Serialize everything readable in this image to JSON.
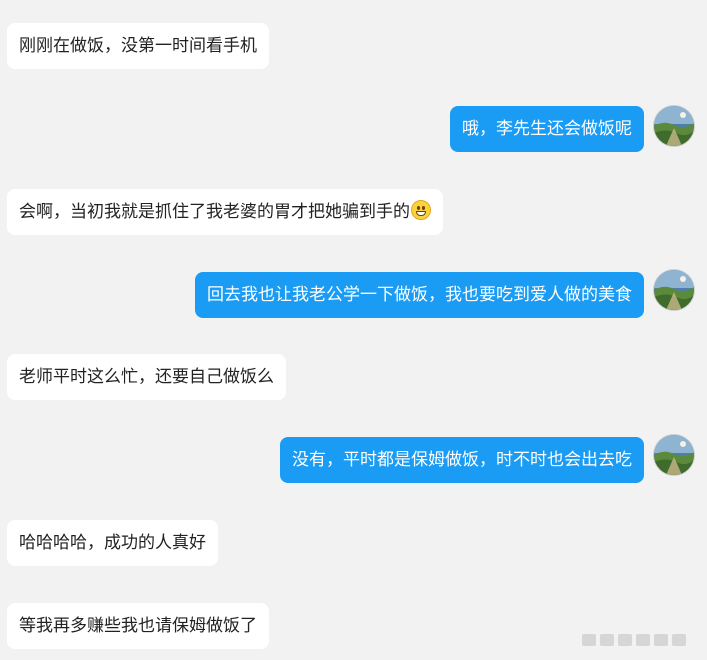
{
  "chat": {
    "messages": [
      {
        "side": "incoming",
        "text": "刚刚在做饭，没第一时间看手机"
      },
      {
        "side": "outgoing",
        "text": "哦，李先生还会做饭呢"
      },
      {
        "side": "incoming",
        "text": "会啊，当初我就是抓住了我老婆的胃才把她骗到手的",
        "emoji": "grinning-face"
      },
      {
        "side": "outgoing",
        "text": "回去我也让我老公学一下做饭，我也要吃到爱人做的美食"
      },
      {
        "side": "incoming",
        "text": "老师平时这么忙，还要自己做饭么"
      },
      {
        "side": "outgoing",
        "text": "没有，平时都是保姆做饭，时不时也会出去吃"
      },
      {
        "side": "incoming",
        "text": "哈哈哈哈，成功的人真好"
      },
      {
        "side": "incoming",
        "text": "等我再多赚些我也请保姆做饭了"
      }
    ]
  },
  "avatar": {
    "icon": "landscape-avatar-icon"
  },
  "colors": {
    "background": "#f2f2f2",
    "incoming_bubble": "#ffffff",
    "outgoing_bubble": "#1a9cf5"
  }
}
